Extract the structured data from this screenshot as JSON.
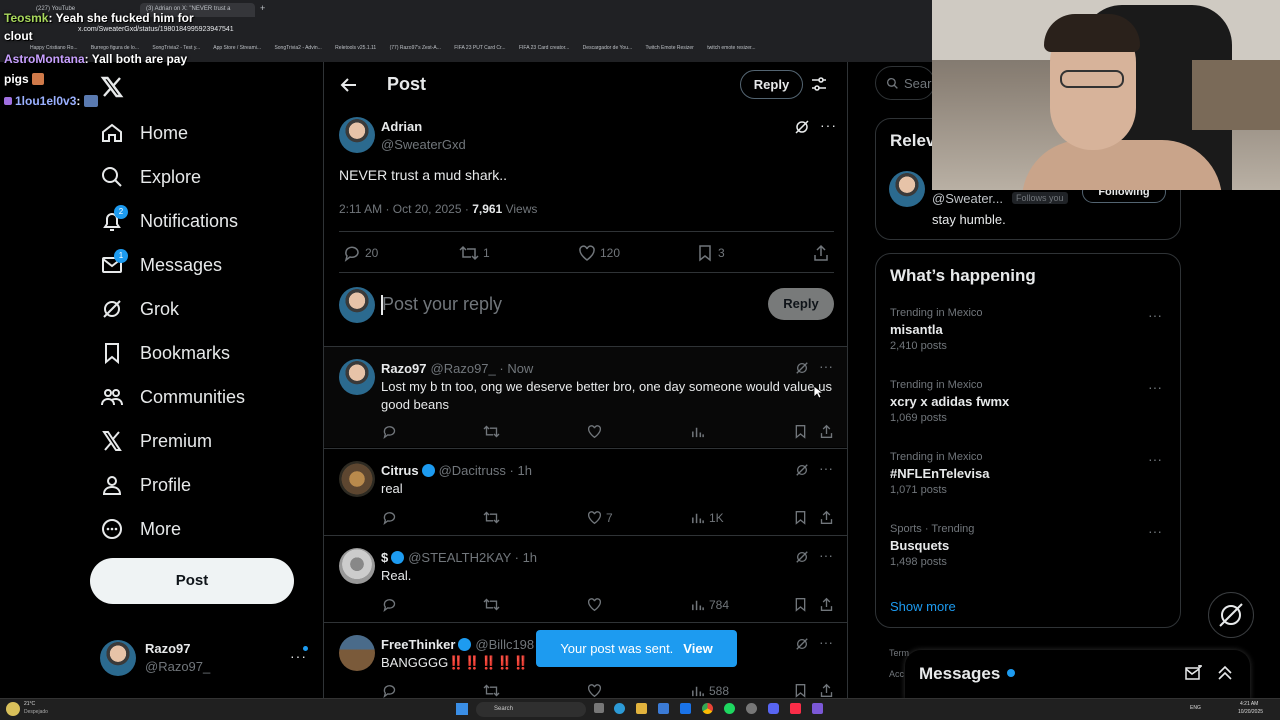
{
  "browser": {
    "tabs": [
      "(227) YouTube",
      "(3) Adrian on X: \"NEVER trust a",
      "+"
    ],
    "url": "x.com/SweaterGxd/status/1980184995923947541",
    "bookmarks": [
      "Happy Cristiano Ro...",
      "Burrego figura de lo...",
      "SongTrivia2 - Test y...",
      "App Store / Streami...",
      "SongTrivia2 - Advin...",
      "Reletools v25.1.11",
      "(77) Razo97's Zest-A...",
      "FIFA 23 PUT Card Cr...",
      "FIFA 23 Card creator...",
      "Descargador de You...",
      "Twitch Emote Resizer",
      "twitch emote resizer..."
    ]
  },
  "chat": [
    {
      "user": "Teosmk",
      "text": ": Yeah she fucked him for"
    },
    {
      "user": "",
      "text": "clout"
    },
    {
      "user": "AstroMontana",
      "text": ": Yall both are pay"
    },
    {
      "user": "",
      "text": "pigs"
    },
    {
      "user": "1lou1el0v3",
      "text": ":"
    }
  ],
  "sidebar": {
    "items": [
      {
        "label": "Home",
        "icon": "home-icon"
      },
      {
        "label": "Explore",
        "icon": "search-icon"
      },
      {
        "label": "Notifications",
        "icon": "bell-icon",
        "badge": "2"
      },
      {
        "label": "Messages",
        "icon": "mail-icon",
        "badge": "1"
      },
      {
        "label": "Grok",
        "icon": "grok-icon"
      },
      {
        "label": "Bookmarks",
        "icon": "bookmark-icon"
      },
      {
        "label": "Communities",
        "icon": "communities-icon"
      },
      {
        "label": "Premium",
        "icon": "x-icon"
      },
      {
        "label": "Profile",
        "icon": "profile-icon"
      },
      {
        "label": "More",
        "icon": "more-icon"
      }
    ],
    "post_label": "Post",
    "account": {
      "name": "Razo97",
      "handle": "@Razo97_"
    }
  },
  "header": {
    "title": "Post",
    "reply_button": "Reply"
  },
  "tweet": {
    "author": "Adrian",
    "handle": "@SweaterGxd",
    "text": "NEVER trust a mud shark..",
    "time": "2:11 AM · Oct 20, 2025 · ",
    "views_count": "7,961",
    "views_label": "Views",
    "replies": "20",
    "reposts": "1",
    "likes": "120",
    "bookmarks": "3"
  },
  "composer": {
    "placeholder": "Post your reply",
    "button": "Reply"
  },
  "replies": [
    {
      "name": "Razo97",
      "handle": "@Razo97_ · Now",
      "text": "Lost my b tn too, ong we deserve better bro, one day someone would value us good beans",
      "likes": "",
      "views": "",
      "verified": false
    },
    {
      "name": "Citrus",
      "handle": "@Dacitruss · 1h",
      "text": "real",
      "likes": "7",
      "views": "1K",
      "verified": true
    },
    {
      "name": "$",
      "handle": "@STEALTH2KAY · 1h",
      "text": "Real.",
      "likes": "",
      "views": "784",
      "verified": true
    },
    {
      "name": "FreeThinker",
      "handle": "@Billc198",
      "text": "BANGGGG‼️‼️‼️‼️‼️",
      "likes": "",
      "views": "588",
      "verified": true
    }
  ],
  "right": {
    "search_placeholder": "Sear",
    "relevant_title": "Relev",
    "relevant_handle": "@Sweater...",
    "follows_you": "Follows you",
    "following": "Following",
    "relevant_bio": "stay humble.",
    "happening_title": "What’s happening",
    "trends": [
      {
        "category": "Trending in Mexico",
        "name": "misantla",
        "count": "2,410 posts"
      },
      {
        "category": "Trending in Mexico",
        "name": "xcry x adidas fwmx",
        "count": "1,069 posts"
      },
      {
        "category": "Trending in Mexico",
        "name": "#NFLEnTelevisa",
        "count": "1,071 posts"
      },
      {
        "category": "Sports · Trending",
        "name": "Busquets",
        "count": "1,498 posts"
      }
    ],
    "show_more": "Show more",
    "footer_1": "Term",
    "footer_2": "Acc"
  },
  "toast": {
    "text": "Your post was sent.",
    "action": "View"
  },
  "messages_drawer": {
    "title": "Messages"
  },
  "taskbar": {
    "weather_temp": "21°C",
    "weather_desc": "Despejado",
    "search": "Search",
    "lang": "ENG",
    "time": "4:21 AM",
    "date": "10/20/2025"
  },
  "colors": {
    "accent": "#1d9bf0",
    "border": "#2f3336",
    "muted": "#71767b",
    "text": "#e7e9ea"
  }
}
